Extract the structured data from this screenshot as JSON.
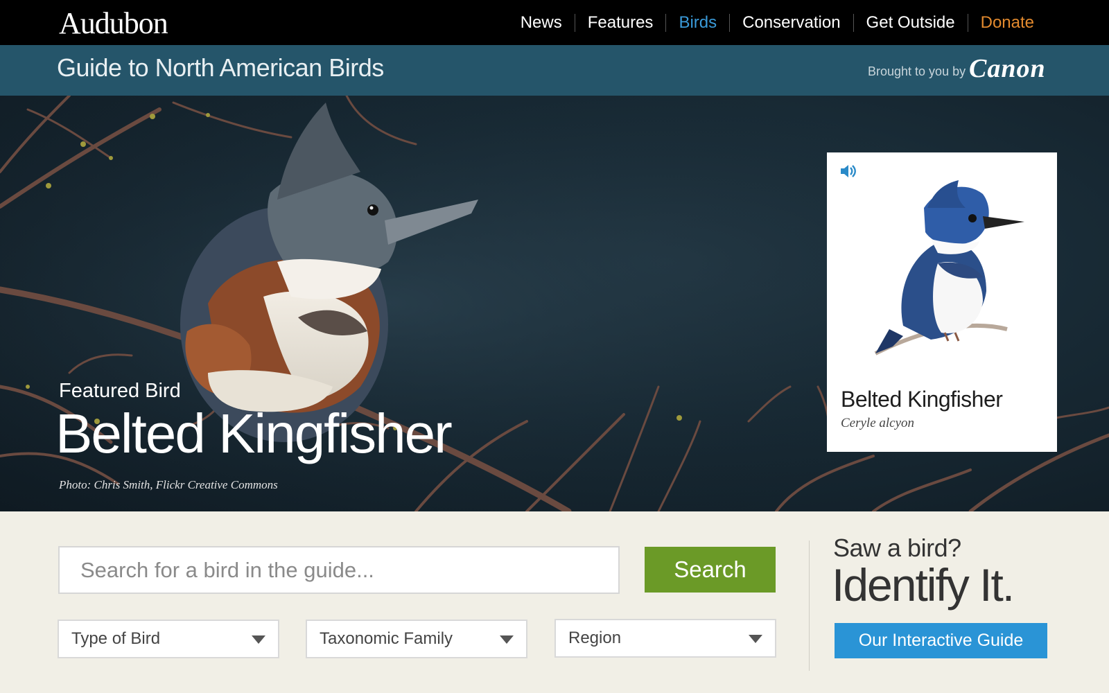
{
  "topnav": {
    "logo": "Audubon",
    "links": [
      "News",
      "Features",
      "Birds",
      "Conservation",
      "Get Outside",
      "Donate"
    ],
    "active": "Birds"
  },
  "subheader": {
    "title": "Guide to North American Birds",
    "sponsor_text": "Brought to you by",
    "sponsor_logo": "Canon"
  },
  "hero": {
    "featured_label": "Featured Bird",
    "featured_name": "Belted Kingfisher",
    "photo_credit": "Photo: Chris Smith, Flickr Creative Commons",
    "card": {
      "common_name": "Belted Kingfisher",
      "scientific_name": "Ceryle alcyon",
      "audio_icon": "speaker-icon"
    }
  },
  "search": {
    "placeholder": "Search for a bird in the guide...",
    "button_label": "Search"
  },
  "filters": [
    {
      "label": "Type of Bird"
    },
    {
      "label": "Taxonomic Family"
    },
    {
      "label": "Region"
    }
  ],
  "identify": {
    "question": "Saw a bird?",
    "headline": "Identify It.",
    "button_label": "Our Interactive Guide"
  },
  "colors": {
    "nav_bg": "#000000",
    "subheader_bg": "#25556a",
    "active_link": "#3a9ad9",
    "donate": "#e38a2e",
    "search_button": "#6b9a27",
    "guide_button": "#2a94d6",
    "page_bg": "#f1efe6"
  }
}
